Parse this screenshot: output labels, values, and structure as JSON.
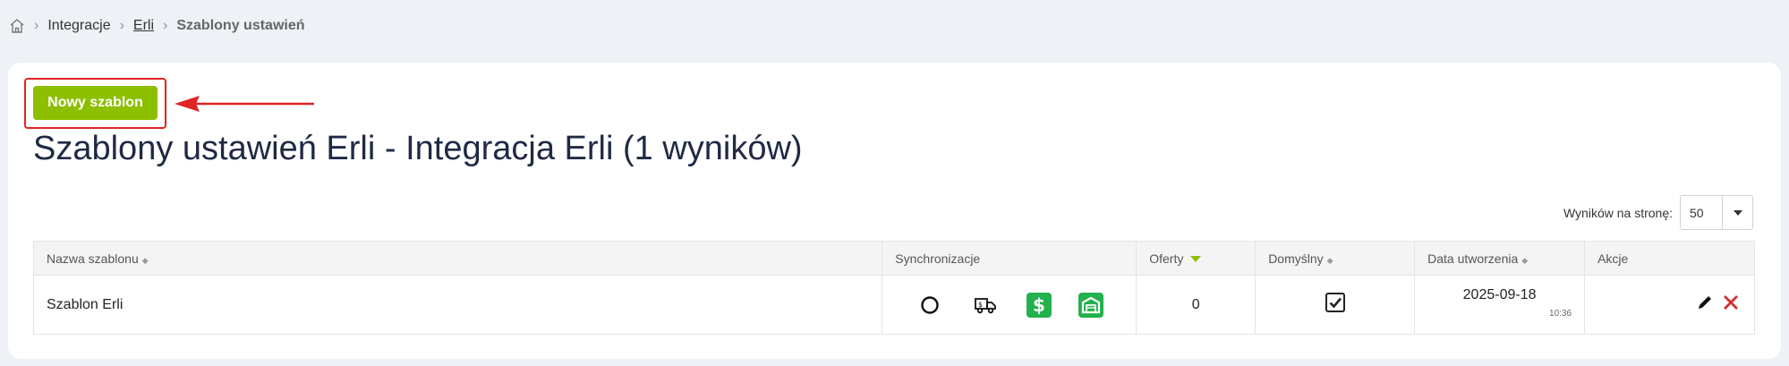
{
  "breadcrumb": {
    "items": [
      "Integracje",
      "Erli",
      "Szablony ustawień"
    ]
  },
  "toolbar": {
    "new_button_label": "Nowy szablon"
  },
  "page": {
    "title": "Szablony ustawień Erli - Integracja Erli (1 wyników)"
  },
  "pagination": {
    "per_page_label": "Wyników na stronę:",
    "per_page_value": "50"
  },
  "table": {
    "headers": {
      "name": "Nazwa szablonu",
      "sync": "Synchronizacje",
      "offers": "Oferty",
      "default": "Domyślny",
      "created": "Data utworzenia",
      "actions": "Akcje"
    },
    "rows": [
      {
        "name": "Szablon Erli",
        "offers": "0",
        "is_default": true,
        "date": "2025-09-18",
        "time": "10:36"
      }
    ]
  },
  "colors": {
    "accent": "#8cbf00",
    "sync_green": "#22b14c",
    "highlight": "#e02424",
    "delete": "#d32f2f"
  },
  "icons": [
    "home-icon",
    "circle-sync-icon",
    "truck-icon",
    "dollar-icon",
    "warehouse-icon",
    "checkbox-icon",
    "edit-icon",
    "delete-icon"
  ]
}
